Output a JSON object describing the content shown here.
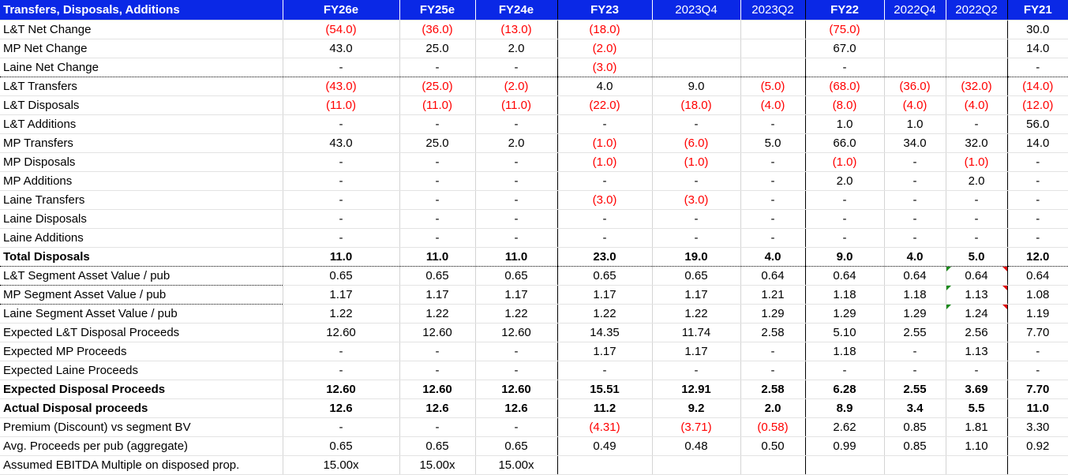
{
  "table": {
    "title": "Transfers, Disposals, Additions",
    "columns": [
      {
        "label": "FY26e",
        "bold": true
      },
      {
        "label": "FY25e",
        "bold": true
      },
      {
        "label": "FY24e",
        "bold": true
      },
      {
        "label": "FY23",
        "bold": true
      },
      {
        "label": "2023Q4",
        "bold": false
      },
      {
        "label": "2023Q2",
        "bold": false
      },
      {
        "label": "FY22",
        "bold": true
      },
      {
        "label": "2022Q4",
        "bold": false
      },
      {
        "label": "2022Q2",
        "bold": false
      },
      {
        "label": "FY21",
        "bold": true
      }
    ],
    "rows": [
      {
        "label": "L&T Net Change",
        "cells": [
          "(54.0)",
          "(36.0)",
          "(13.0)",
          "(18.0)",
          "",
          "",
          "(75.0)",
          "",
          "",
          "30.0"
        ]
      },
      {
        "label": "MP Net Change",
        "cells": [
          "43.0",
          "25.0",
          "2.0",
          "(2.0)",
          "",
          "",
          "67.0",
          "",
          "",
          "14.0"
        ]
      },
      {
        "label": "Laine Net Change",
        "cells": [
          "-",
          "-",
          "-",
          "(3.0)",
          "",
          "",
          "-",
          "",
          "",
          "-"
        ],
        "dotted": true
      },
      {
        "label": "L&T Transfers",
        "cells": [
          "(43.0)",
          "(25.0)",
          "(2.0)",
          "4.0",
          "9.0",
          "(5.0)",
          "(68.0)",
          "(36.0)",
          "(32.0)",
          "(14.0)"
        ]
      },
      {
        "label": "L&T Disposals",
        "cells": [
          "(11.0)",
          "(11.0)",
          "(11.0)",
          "(22.0)",
          "(18.0)",
          "(4.0)",
          "(8.0)",
          "(4.0)",
          "(4.0)",
          "(12.0)"
        ]
      },
      {
        "label": "L&T Additions",
        "cells": [
          "-",
          "-",
          "-",
          "-",
          "-",
          "-",
          "1.0",
          "1.0",
          "-",
          "56.0"
        ]
      },
      {
        "label": "MP Transfers",
        "cells": [
          "43.0",
          "25.0",
          "2.0",
          "(1.0)",
          "(6.0)",
          "5.0",
          "66.0",
          "34.0",
          "32.0",
          "14.0"
        ]
      },
      {
        "label": "MP Disposals",
        "cells": [
          "-",
          "-",
          "-",
          "(1.0)",
          "(1.0)",
          "-",
          "(1.0)",
          "-",
          "(1.0)",
          "-"
        ]
      },
      {
        "label": "MP Additions",
        "cells": [
          "-",
          "-",
          "-",
          "-",
          "-",
          "-",
          "2.0",
          "-",
          "2.0",
          "-"
        ]
      },
      {
        "label": "Laine Transfers",
        "cells": [
          "-",
          "-",
          "-",
          "(3.0)",
          "(3.0)",
          "-",
          "-",
          "-",
          "-",
          "-"
        ]
      },
      {
        "label": "Laine Disposals",
        "cells": [
          "-",
          "-",
          "-",
          "-",
          "-",
          "-",
          "-",
          "-",
          "-",
          "-"
        ]
      },
      {
        "label": "Laine Additions",
        "cells": [
          "-",
          "-",
          "-",
          "-",
          "-",
          "-",
          "-",
          "-",
          "-",
          "-"
        ]
      },
      {
        "label": "Total Disposals",
        "cells": [
          "11.0",
          "11.0",
          "11.0",
          "23.0",
          "19.0",
          "4.0",
          "9.0",
          "4.0",
          "5.0",
          "12.0"
        ],
        "bold": true,
        "dotted": true
      },
      {
        "label": "L&T Segment Asset Value / pub",
        "cells": [
          "0.65",
          "0.65",
          "0.65",
          "0.65",
          "0.65",
          "0.64",
          "0.64",
          "0.64",
          "0.64",
          "0.64"
        ],
        "dotlabel": true,
        "marks": true
      },
      {
        "label": "MP Segment Asset Value / pub",
        "cells": [
          "1.17",
          "1.17",
          "1.17",
          "1.17",
          "1.17",
          "1.21",
          "1.18",
          "1.18",
          "1.13",
          "1.08"
        ],
        "dotlabel": true,
        "marks": true
      },
      {
        "label": "Laine Segment Asset Value / pub",
        "cells": [
          "1.22",
          "1.22",
          "1.22",
          "1.22",
          "1.22",
          "1.29",
          "1.29",
          "1.29",
          "1.24",
          "1.19"
        ],
        "marks": true
      },
      {
        "label": "Expected L&T Disposal Proceeds",
        "cells": [
          "12.60",
          "12.60",
          "12.60",
          "14.35",
          "11.74",
          "2.58",
          "5.10",
          "2.55",
          "2.56",
          "7.70"
        ]
      },
      {
        "label": "Expected MP Proceeds",
        "cells": [
          "-",
          "-",
          "-",
          "1.17",
          "1.17",
          "-",
          "1.18",
          "-",
          "1.13",
          "-"
        ]
      },
      {
        "label": "Expected Laine Proceeds",
        "cells": [
          "-",
          "-",
          "-",
          "-",
          "-",
          "-",
          "-",
          "-",
          "-",
          "-"
        ]
      },
      {
        "label": "Expected Disposal Proceeds",
        "cells": [
          "12.60",
          "12.60",
          "12.60",
          "15.51",
          "12.91",
          "2.58",
          "6.28",
          "2.55",
          "3.69",
          "7.70"
        ],
        "bold": true
      },
      {
        "label": "Actual Disposal proceeds",
        "cells": [
          "12.6",
          "12.6",
          "12.6",
          "11.2",
          "9.2",
          "2.0",
          "8.9",
          "3.4",
          "5.5",
          "11.0"
        ],
        "bold": true
      },
      {
        "label": "Premium (Discount) vs segment BV",
        "cells": [
          "-",
          "-",
          "-",
          "(4.31)",
          "(3.71)",
          "(0.58)",
          "2.62",
          "0.85",
          "1.81",
          "3.30"
        ]
      },
      {
        "label": "Avg. Proceeds per pub (aggregate)",
        "cells": [
          "0.65",
          "0.65",
          "0.65",
          "0.49",
          "0.48",
          "0.50",
          "0.99",
          "0.85",
          "1.10",
          "0.92"
        ]
      },
      {
        "label": "Assumed EBITDA Multiple on disposed prop.",
        "cells": [
          "15.00x",
          "15.00x",
          "15.00x",
          "",
          "",
          "",
          "",
          "",
          "",
          ""
        ]
      }
    ]
  }
}
